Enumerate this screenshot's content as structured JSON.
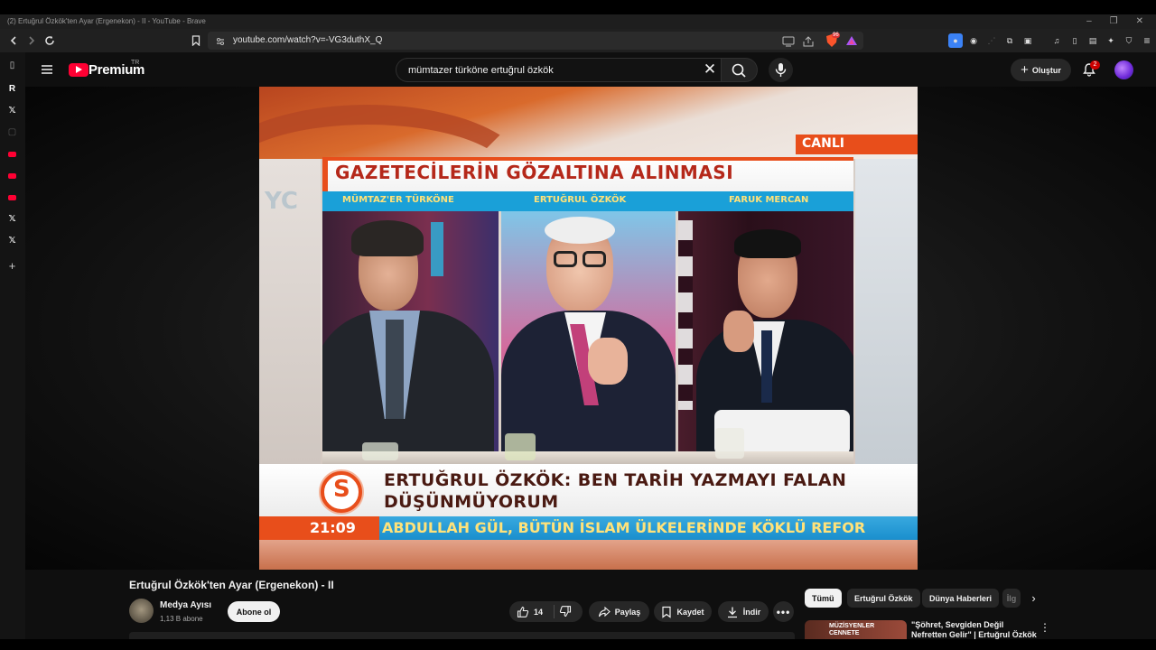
{
  "browser": {
    "window_title": "(2) Ertuğrul Özkök'ten Ayar (Ergenekon) - II - YouTube - Brave",
    "url": "youtube.com/watch?v=-VG3duthX_Q",
    "shields_count": "96"
  },
  "youtube": {
    "brand": "Premium",
    "region": "TR",
    "search": {
      "value": "mümtazer türköne ertuğrul özkök",
      "clear_icon": "close-icon"
    },
    "create_label": "Oluştur",
    "notifications_count": "2"
  },
  "video": {
    "title": "Ertuğrul Özkök'ten Ayar (Ergenekon) - II",
    "channel": {
      "name": "Medya Ayısı",
      "subscribers": "1,13 B abone"
    },
    "subscribe_label": "Abone ol",
    "likes": "14",
    "share_label": "Paylaş",
    "save_label": "Kaydet",
    "download_label": "İndir",
    "broadcast": {
      "live_tag": "CANLI",
      "headline": "GAZETECİLERİN GÖZALTINA ALINMASI",
      "guests": [
        "MÜMTAZ'ER TÜRKÖNE",
        "ERTUĞRUL ÖZKÖK",
        "FARUK MERCAN"
      ],
      "lower_third_line1": "ERTUĞRUL ÖZKÖK: BEN TARİH YAZMAYI FALAN",
      "lower_third_line2": "DÜŞÜNMÜYORUM",
      "logo_letter": "S",
      "clock": "21:09",
      "ticker": "ABDULLAH GÜL, BÜTÜN İSLAM ÜLKELERİNDE KÖKLÜ REFOR"
    }
  },
  "related": {
    "chips": [
      "Tümü",
      "Ertuğrul Özkök",
      "Dünya Haberleri",
      "İlg"
    ],
    "first_item": {
      "thumb_text": "MÜZİSYENLER CENNETE",
      "title": "\"Şöhret, Sevgiden Değil Nefretten Gelir\" | Ertuğrul Özkök"
    }
  },
  "colors": {
    "yt_red": "#ff0033",
    "page_bg": "#0f0f0f",
    "broadcast_orange": "#e84e1b",
    "broadcast_blue": "#1aa0d8"
  }
}
